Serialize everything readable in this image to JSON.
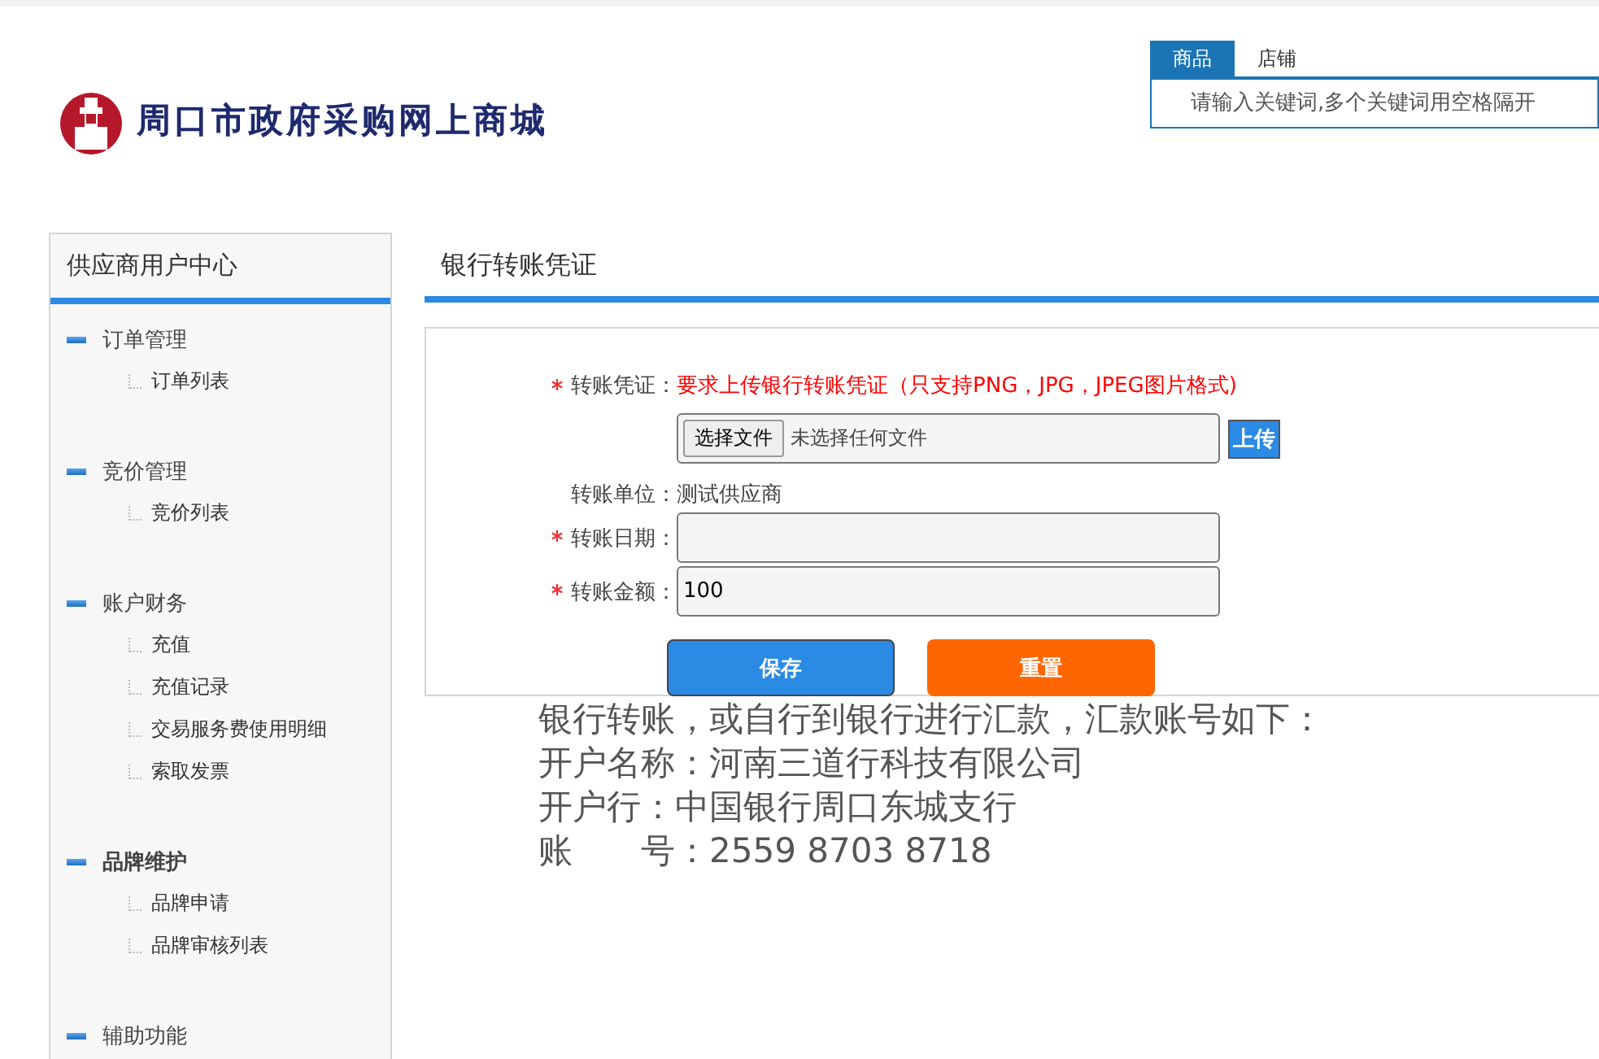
{
  "logo": {
    "title": "周口市政府采购网上商城"
  },
  "search": {
    "tabs": [
      {
        "label": "商品",
        "selected": true
      },
      {
        "label": "店铺",
        "selected": false
      }
    ],
    "placeholder": "请输入关键词,多个关键词用空格隔开"
  },
  "sidebar": {
    "title": "供应商用户中心",
    "groups": [
      {
        "label": "订单管理",
        "active": false,
        "items": [
          "订单列表"
        ]
      },
      {
        "label": "竞价管理",
        "active": false,
        "items": [
          "竞价列表"
        ]
      },
      {
        "label": "账户财务",
        "active": false,
        "items": [
          "充值",
          "充值记录",
          "交易服务费使用明细",
          "索取发票"
        ]
      },
      {
        "label": "品牌维护",
        "active": true,
        "items": [
          "品牌申请",
          "品牌审核列表"
        ]
      },
      {
        "label": "辅助功能",
        "active": false
      }
    ]
  },
  "page_title": "银行转账凭证",
  "form": {
    "rows": [
      {
        "kind": "file",
        "label": "转账凭证：",
        "required": true,
        "hint": "要求上传银行转账凭证（只支持PNG，JPG，JPEG图片格式)",
        "choose_button": "选择文件",
        "file_status": "未选择任何文件",
        "upload_button": "上传"
      },
      {
        "kind": "text",
        "label": "转账单位：",
        "required": false,
        "value": "测试供应商"
      },
      {
        "kind": "input",
        "label": "转账日期：",
        "required": true,
        "value": ""
      },
      {
        "kind": "input",
        "label": "转账金额：",
        "required": true,
        "value": "100"
      }
    ],
    "buttons": [
      {
        "label": "保存",
        "kind": "primary"
      },
      {
        "label": "重置",
        "kind": "warning"
      }
    ]
  },
  "notes": [
    "银行转账，或自行到银行进行汇款，汇款账号如下：",
    "开户名称：河南三道行科技有限公司",
    "开户行：中国银行周口东城支行",
    "账　　号：2559 8703 8718"
  ]
}
